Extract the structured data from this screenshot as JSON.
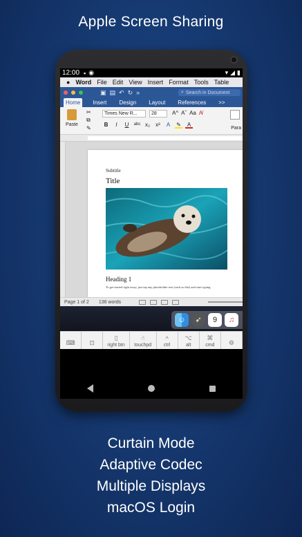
{
  "headline": "Apple Screen Sharing",
  "features": [
    "Curtain Mode",
    "Adaptive Codec",
    "Multiple Displays",
    "macOS Login"
  ],
  "android_status": {
    "time": "12:00"
  },
  "mac_menu": {
    "apple": "",
    "app": "Word",
    "items": [
      "File",
      "Edit",
      "View",
      "Insert",
      "Format",
      "Tools",
      "Table"
    ]
  },
  "word": {
    "search_placeholder": "Search in Document",
    "tabs": [
      "Home",
      "Insert",
      "Design",
      "Layout",
      "References",
      ">>"
    ],
    "paste_label": "Paste",
    "font_name": "Times New R...",
    "font_size": "28",
    "para_label": "Para",
    "document": {
      "subtitle": "Subtitle",
      "title": "Title",
      "heading": "Heading 1",
      "body": "To get started right away, just tap any placeholder text (such as this) and start typing."
    },
    "status": {
      "page": "Page 1 of 2",
      "words": "136 words"
    }
  },
  "dock": {
    "calendar_day": "9"
  },
  "keybar": [
    {
      "icon": "keyboard-icon",
      "label": ""
    },
    {
      "icon": "window-icon",
      "label": ""
    },
    {
      "icon": "mouse-icon",
      "label": "right btn"
    },
    {
      "icon": "touchpad-icon",
      "label": "touchpd"
    },
    {
      "icon": "ctrl-icon",
      "label": "ctrl"
    },
    {
      "icon": "alt-icon",
      "label": "alt"
    },
    {
      "icon": "cmd-icon",
      "label": "cmd"
    },
    {
      "icon": "gear-icon",
      "label": ""
    }
  ],
  "colors": {
    "background": "#163a72",
    "word_blue": "#2b5797",
    "close": "#fc605c",
    "minimize": "#fdbc40",
    "zoom": "#34c84a"
  }
}
